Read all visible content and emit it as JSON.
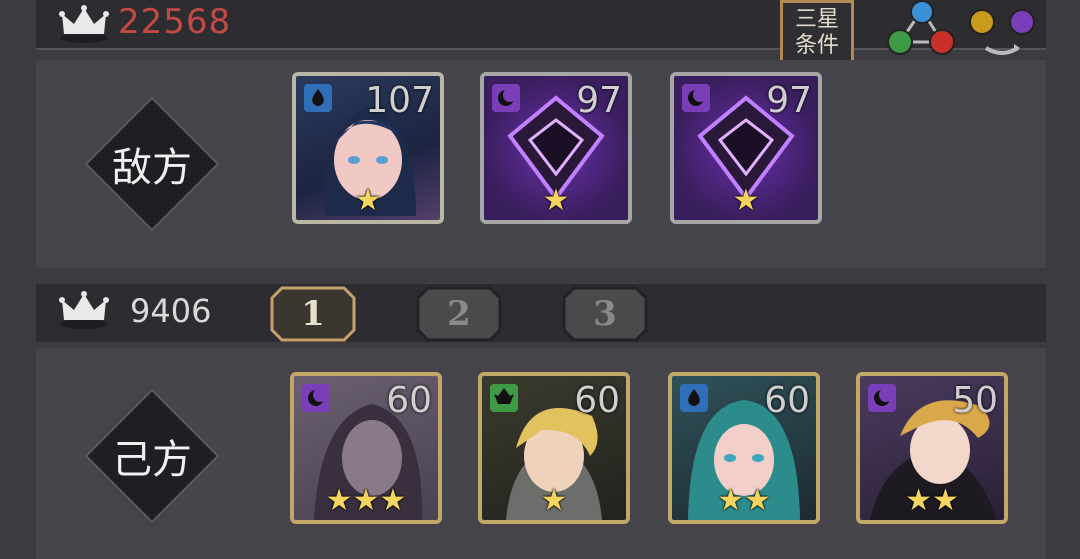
{
  "enemy": {
    "power": "22568",
    "side_label": "敌方",
    "units": [
      {
        "level": "107",
        "element": "water",
        "stars": "★"
      },
      {
        "level": "97",
        "element": "dark",
        "stars": "★"
      },
      {
        "level": "97",
        "element": "dark",
        "stars": "★"
      }
    ]
  },
  "star_condition": {
    "line1": "三星",
    "line2": "条件"
  },
  "ally": {
    "power": "9406",
    "side_label": "己方",
    "units": [
      {
        "level": "60",
        "element": "dark",
        "stars": "★★★"
      },
      {
        "level": "60",
        "element": "nature",
        "stars": "★"
      },
      {
        "level": "60",
        "element": "water",
        "stars": "★★"
      },
      {
        "level": "50",
        "element": "dark",
        "stars": "★★"
      }
    ]
  },
  "team_tabs": [
    "1",
    "2",
    "3"
  ],
  "icons": {
    "crown": "crown-icon",
    "element_cycle": "element-cycle-icon",
    "light_dark_cycle": "light-dark-cycle-icon"
  },
  "colors": {
    "enemy_power": "#c14a42",
    "gold_frame": "#b28a4f",
    "star": "#f2d45f"
  }
}
